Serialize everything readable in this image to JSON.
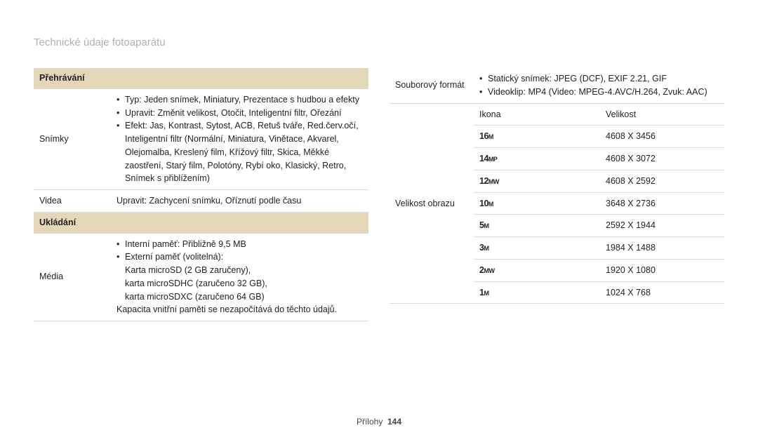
{
  "page_title": "Technické údaje fotoaparátu",
  "left": {
    "section1": "Přehrávání",
    "row_snimky_label": "Snímky",
    "row_snimky_b1": "Typ: Jeden snímek, Miniatury, Prezentace s hudbou a efekty",
    "row_snimky_b2": "Upravit: Změnit velikost, Otočit, Inteligentní filtr, Ořezání",
    "row_snimky_b3": "Efekt: Jas, Kontrast, Sytost, ACB, Retuš tváře, Red.červ.očí, Inteligentní filtr (Normální, Miniatura, Vinětace, Akvarel, Olejomalba, Kreslený film, Křížový filtr, Skica, Měkké zaostření, Starý film, Polotóny, Rybí oko, Klasický, Retro, Snímek s přiblížením)",
    "row_videa_label": "Videa",
    "row_videa_val": "Upravit: Zachycení snímku, Oříznutí podle času",
    "section2": "Ukládání",
    "row_media_label": "Média",
    "row_media_b1": "Interní paměť: Přibližně 9,5 MB",
    "row_media_b2_lead": "Externí paměť (volitelná):",
    "row_media_b2_l1": "Karta microSD (2 GB zaručeny),",
    "row_media_b2_l2": "karta microSDHC (zaručeno 32 GB),",
    "row_media_b2_l3": "karta microSDXC (zaručeno 64 GB)",
    "row_media_note": "Kapacita vnitřní paměti se nezapočítává do těchto údajů."
  },
  "right": {
    "row_format_label": "Souborový formát",
    "row_format_b1": "Statický snímek: JPEG (DCF), EXIF 2.21, GIF",
    "row_format_b2": "Videoklip: MP4 (Video: MPEG-4.AVC/H.264, Zvuk: AAC)",
    "row_size_label": "Velikost obrazu",
    "header_icon": "Ikona",
    "header_size": "Velikost",
    "sizes": {
      "s0_icon_main": "16",
      "s0_icon_sub": "M",
      "s0_val": "4608 X 3456",
      "s1_icon_main": "14",
      "s1_icon_sub": "MP",
      "s1_val": "4608 X 3072",
      "s2_icon_main": "12",
      "s2_icon_sub": "MW",
      "s2_val": "4608 X 2592",
      "s3_icon_main": "10",
      "s3_icon_sub": "M",
      "s3_val": "3648 X 2736",
      "s4_icon_main": "5",
      "s4_icon_sub": "M",
      "s4_val": "2592 X 1944",
      "s5_icon_main": "3",
      "s5_icon_sub": "M",
      "s5_val": "1984 X 1488",
      "s6_icon_main": "2",
      "s6_icon_sub": "MW",
      "s6_val": "1920 X 1080",
      "s7_icon_main": "1",
      "s7_icon_sub": "M",
      "s7_val": "1024 X 768"
    }
  },
  "footer": {
    "label": "Přílohy",
    "page": "144"
  }
}
